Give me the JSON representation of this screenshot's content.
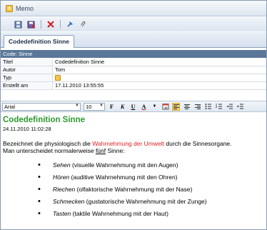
{
  "window": {
    "title": "Memo"
  },
  "toolbar": {
    "buttons": [
      "save-icon",
      "save-close-icon",
      "delete-icon",
      "pin-icon",
      "attach-icon"
    ]
  },
  "tabs": [
    {
      "label": "Codedefinition Sinne"
    }
  ],
  "section": {
    "header": "Code: Sinne"
  },
  "properties": [
    {
      "label": "Titel",
      "value": "Codedefinition Sinne"
    },
    {
      "label": "Autor",
      "value": "Tom"
    },
    {
      "label": "Typ",
      "value": ""
    },
    {
      "label": "Erstellt am",
      "value": "17.11.2010 13:55:55"
    }
  ],
  "editor": {
    "font": "Arial",
    "size": "10",
    "bold": "F",
    "italic": "K",
    "underline": "U",
    "color_label": "A"
  },
  "document": {
    "title": "Codedefinition Sinne",
    "date": "24.11.2010 11:02:28",
    "para_part1": "Bezeichnet die physiologisch die ",
    "para_highlight": "Wahrnehmung der Umwelt",
    "para_part2": " durch die Sinnesorgane.",
    "para_line2_a": "Man unterscheidet normalerweise ",
    "para_line2_u": "fünf",
    "para_line2_b": " Sinne:",
    "senses": [
      {
        "name": "Sehen",
        "desc": " (visuelle Wahrnehmung mit den Augen)"
      },
      {
        "name": "Hören",
        "desc": " (auditive Wahrnehmung mit den Ohren)"
      },
      {
        "name": "Riechen",
        "desc": " (olfaktorische Wahrnehmung mit der Nase)"
      },
      {
        "name": "Schmecken",
        "desc": " (gustatorische Wahrnehmung mit der Zunge)"
      },
      {
        "name": "Tasten",
        "desc": " (taktile Wahrnehmung mit der Haut)"
      }
    ]
  },
  "colors": {
    "title_green": "#2d9a2d",
    "highlight_red": "#e02020",
    "section_header": "#5a7799"
  }
}
